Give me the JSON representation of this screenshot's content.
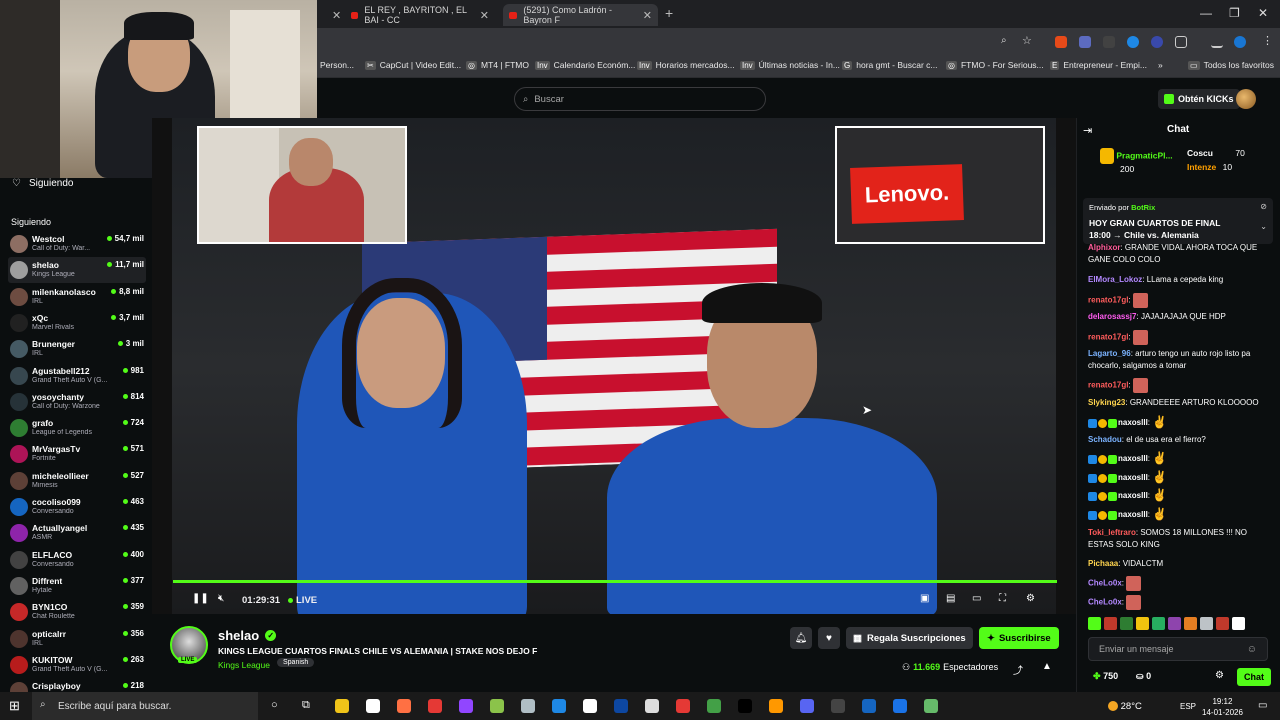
{
  "browser": {
    "tabs": [
      {
        "label": "EL REY , BAYRITON , EL BAI - CC"
      },
      {
        "label": "(5291) Como Ladrón - Bayron F"
      }
    ],
    "bookmarks": [
      "Person...",
      "CapCut | Video Edit...",
      "MT4 | FTMO",
      "Calendario Económ...",
      "Horarios mercados...",
      "Últimas noticias - In...",
      "hora gmt - Buscar c...",
      "FTMO - For Serious...",
      "Entrepreneur - Empi...",
      "Todos los favoritos"
    ]
  },
  "kick": {
    "search_placeholder": "Buscar",
    "get_kicks": "Obtén KICKs"
  },
  "sidebar": {
    "title": "Siguiendo",
    "subtitle": "Siguiendo",
    "channels": [
      {
        "name": "Westcol",
        "game": "Call of Duty: War...",
        "viewers": "54,7 mil",
        "color": "#8d6e63"
      },
      {
        "name": "shelao",
        "game": "Kings League",
        "viewers": "11,7 mil",
        "color": "#9e9e9e"
      },
      {
        "name": "milenkanolasco",
        "game": "IRL",
        "viewers": "8,8 mil",
        "color": "#6d4c41"
      },
      {
        "name": "xQc",
        "game": "Marvel Rivals",
        "viewers": "3,7 mil",
        "color": "#212121"
      },
      {
        "name": "Brunenger",
        "game": "IRL",
        "viewers": "3 mil",
        "color": "#455a64"
      },
      {
        "name": "Agustabell212",
        "game": "Grand Theft Auto V (G...",
        "viewers": "981",
        "color": "#37474f"
      },
      {
        "name": "yosoychanty",
        "game": "Call of Duty: Warzone",
        "viewers": "814",
        "color": "#263238"
      },
      {
        "name": "grafo",
        "game": "League of Legends",
        "viewers": "724",
        "color": "#2e7d32"
      },
      {
        "name": "MrVargasTv",
        "game": "Fortnite",
        "viewers": "571",
        "color": "#ad1457"
      },
      {
        "name": "micheleollieer",
        "game": "Mimesis",
        "viewers": "527",
        "color": "#5d4037"
      },
      {
        "name": "cocoliso099",
        "game": "Conversando",
        "viewers": "463",
        "color": "#1565c0"
      },
      {
        "name": "Actuallyangel",
        "game": "ASMR",
        "viewers": "435",
        "color": "#8e24aa"
      },
      {
        "name": "ELFLACO",
        "game": "Conversando",
        "viewers": "400",
        "color": "#424242"
      },
      {
        "name": "Diffrent",
        "game": "Hytale",
        "viewers": "377",
        "color": "#616161"
      },
      {
        "name": "BYN1CO",
        "game": "Chat Roulette",
        "viewers": "359",
        "color": "#c62828"
      },
      {
        "name": "opticalrr",
        "game": "IRL",
        "viewers": "356",
        "color": "#4e342e"
      },
      {
        "name": "KUKITOW",
        "game": "Grand Theft Auto V (G...",
        "viewers": "263",
        "color": "#b71c1c"
      },
      {
        "name": "Crisplayboy",
        "game": "",
        "viewers": "218",
        "color": "#5d4037"
      }
    ]
  },
  "video": {
    "time": "01:29:31",
    "live": "LIVE",
    "lenovo": "Lenovo."
  },
  "stream": {
    "name": "shelao",
    "live_badge": "LIVE",
    "title": "KINGS LEAGUE CUARTOS FINALS CHILE VS ALEMANIA | STAKE NOS DEJO F",
    "category": "Kings League",
    "language": "Spanish",
    "gift_label": "Regala Suscripciones",
    "subscribe_label": "Suscribirse",
    "viewers_count": "11.669",
    "viewers_label": "Espectadores"
  },
  "chat": {
    "title": "Chat",
    "leaderboard": [
      {
        "name": "PragmaticPl...",
        "amount": "200"
      },
      {
        "name": "Coscu",
        "amount": "70"
      },
      {
        "name": "Intenze",
        "amount": "10"
      }
    ],
    "pinned": {
      "sent_by": "Enviado por",
      "bot": "BotRix",
      "text": "HOY GRAN CUARTOS DE FINAL",
      "text2": "18:00 → Chile",
      "text3": "vs. Alemania"
    },
    "messages": [
      {
        "user": "Alphixor",
        "color": "#ff5c9a",
        "text": "GRANDE VIDAL AHORA TOCA QUE GANE COLO COLO"
      },
      {
        "user": "ElMora_Lokoz",
        "color": "#b388ff",
        "text": "LLama a cepeda king"
      },
      {
        "user": "renato17gl",
        "color": "#ff5c5c",
        "text": ""
      },
      {
        "user": "delarosassj7",
        "color": "#ff5cf0",
        "text": "JAJAJAJAJA QUE HDP"
      },
      {
        "user": "renato17gl",
        "color": "#ff5c5c",
        "text": ""
      },
      {
        "user": "Lagarto_96",
        "color": "#7bb3ff",
        "text": "arturo tengo un auto rojo listo pa chocarlo, salgamos a tomar"
      },
      {
        "user": "renato17gl",
        "color": "#ff5c5c",
        "text": ""
      },
      {
        "user": "Slyking23",
        "color": "#ffd54f",
        "text": "GRANDEEEE ARTURO KLOOOOO"
      },
      {
        "user": "naxoslll",
        "color": "#ffffff",
        "text": ""
      },
      {
        "user": "Schadou",
        "color": "#7bb3ff",
        "text": "el de usa era el fierro?"
      },
      {
        "user": "naxoslll",
        "color": "#ffffff",
        "text": ""
      },
      {
        "user": "naxoslll",
        "color": "#ffffff",
        "text": ""
      },
      {
        "user": "naxoslll",
        "color": "#ffffff",
        "text": ""
      },
      {
        "user": "naxoslll",
        "color": "#ffffff",
        "text": ""
      },
      {
        "user": "Toki_leftraro",
        "color": "#ff5c5c",
        "text": "SOMOS 18 MILLONES !!! NO ESTAS SOLO KING"
      },
      {
        "user": "Pichaaa",
        "color": "#ffd54f",
        "text": "VIDALCTM"
      },
      {
        "user": "CheLo0x",
        "color": "#b388ff",
        "text": ""
      },
      {
        "user": "CheLo0x",
        "color": "#b388ff",
        "text": ""
      }
    ],
    "input_placeholder": "Enviar un mensaje",
    "points": "750",
    "points2": "0",
    "send_label": "Chat"
  },
  "taskbar": {
    "search": "Escribe aquí para buscar.",
    "weather": "28°C",
    "lang": "ESP",
    "time": "19:12",
    "date": "14-01-2026"
  }
}
